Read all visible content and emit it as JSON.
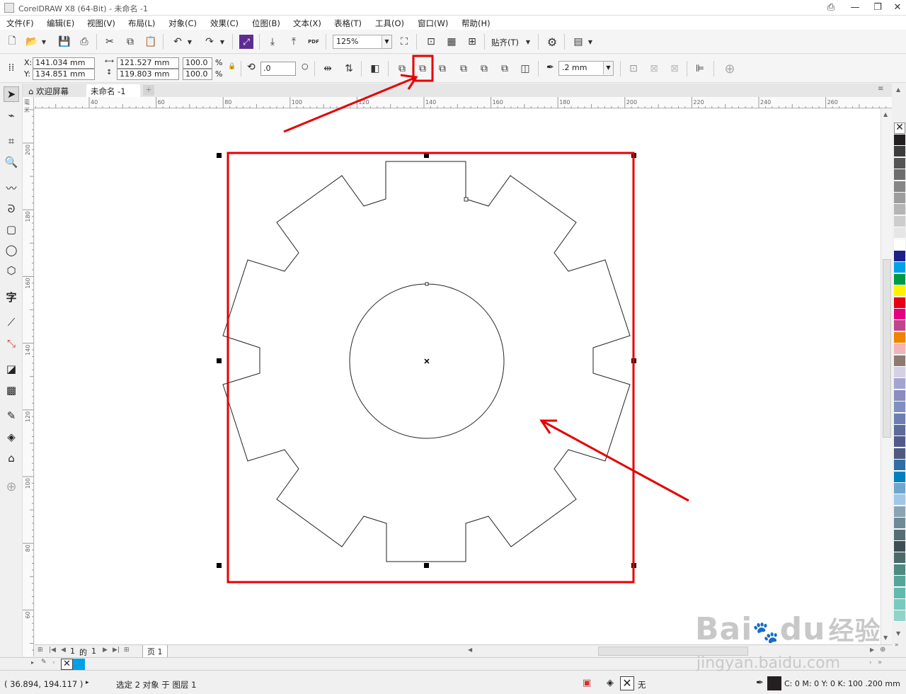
{
  "title_bar": {
    "title": "CorelDRAW X8 (64-Bit) - 未命名 -1"
  },
  "menu": [
    "文件(F)",
    "编辑(E)",
    "视图(V)",
    "布局(L)",
    "对象(C)",
    "效果(C)",
    "位图(B)",
    "文本(X)",
    "表格(T)",
    "工具(O)",
    "窗口(W)",
    "帮助(H)"
  ],
  "toolbar": {
    "zoom": "125%",
    "align_label": "贴齐(T)",
    "pdf_label": "PDF"
  },
  "props": {
    "x_label": "X:",
    "y_label": "Y:",
    "x": "141.034 mm",
    "y": "134.851 mm",
    "w": "121.527 mm",
    "h": "119.803 mm",
    "sx": "100.0",
    "sy": "100.0",
    "pct": "%",
    "angle": ".0",
    "outline": ".2 mm"
  },
  "tabs": {
    "welcome": "欢迎屏幕",
    "document": "未命名 -1"
  },
  "ruler": {
    "h": [
      "40",
      "60",
      "80",
      "100",
      "120",
      "140",
      "160",
      "180",
      "200",
      "220",
      "240",
      "260"
    ],
    "v": [
      "200",
      "180",
      "160",
      "140",
      "120",
      "100",
      "80",
      "60"
    ],
    "unit": "毫米"
  },
  "pages": {
    "current": "1",
    "of": "的",
    "total": "1",
    "tab": "页 1"
  },
  "status": {
    "coords": "( 36.894, 194.117 )",
    "selection": "选定 2 对象 于 图层 1",
    "fill_none": "无",
    "color_info": "C: 0 M: 0 Y: 0 K: 100  .200 mm"
  },
  "watermark": {
    "brand": "Bai",
    "paw": "du",
    "cn": "经验",
    "url": "jingyan.baidu.com"
  },
  "colors": {
    "highlight": "#e60000",
    "palette": [
      "#231f20",
      "#3c3c3c",
      "#555555",
      "#6d6d6d",
      "#858585",
      "#9d9d9d",
      "#b5b5b5",
      "#cdcdcd",
      "#e6e6e6",
      "#ffffff",
      "#1d2088",
      "#00a0e9",
      "#009944",
      "#fff100",
      "#e60012",
      "#e4007f",
      "#c0458c",
      "#f08300",
      "#f2b5b6",
      "#8c7b70",
      "#d4d1e6",
      "#a4a4d0",
      "#8b8bc0",
      "#7f8fbf",
      "#6d7fb2",
      "#5b6c99",
      "#515b8a",
      "#4e5b7f",
      "#2e6ea5",
      "#007fc1",
      "#6ea6cf",
      "#a0c7e4",
      "#8ba4b4",
      "#6d8a96",
      "#566d75",
      "#3e4e55",
      "#496c6a",
      "#4e8a80",
      "#55a59a",
      "#62b9ad",
      "#79c9be",
      "#8fd3c9"
    ]
  }
}
